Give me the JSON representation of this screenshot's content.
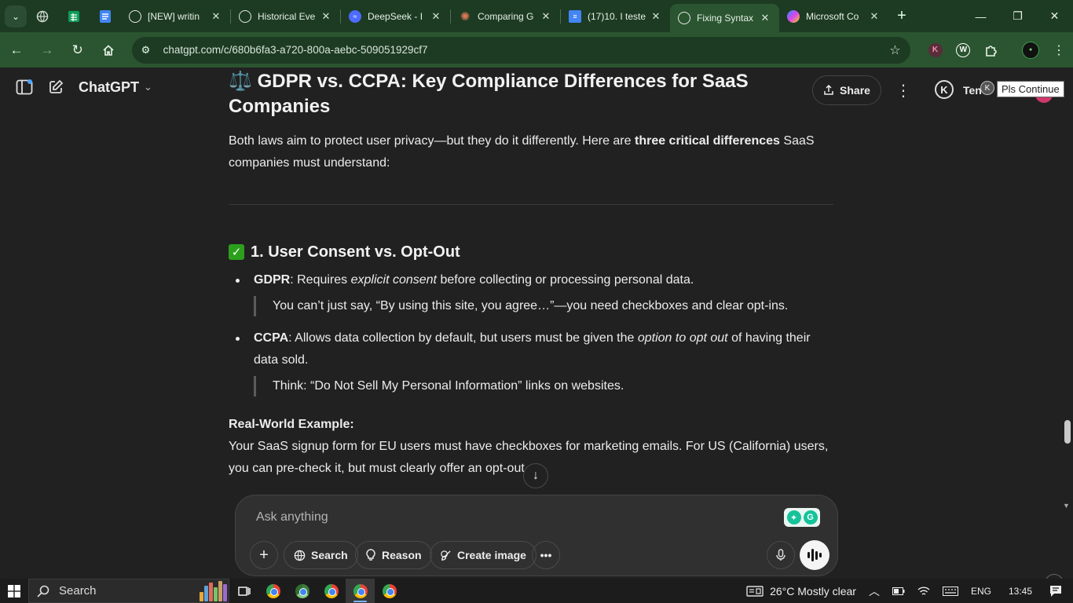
{
  "browser": {
    "tabs": [
      {
        "title": "[NEW] writin",
        "favicon": "openai-icon",
        "color": "#e8e8e8"
      },
      {
        "title": "Historical Eve",
        "favicon": "openai-icon",
        "color": "#e8e8e8"
      },
      {
        "title": "DeepSeek - I",
        "favicon": "deepseek-icon",
        "color": "#4d6bfe"
      },
      {
        "title": "Comparing G",
        "favicon": "claude-icon",
        "color": "#d97757"
      },
      {
        "title": "(17)10. I teste",
        "favicon": "docs-icon",
        "color": "#4285f4"
      },
      {
        "title": "Fixing Syntax",
        "favicon": "openai-icon",
        "color": "#e8e8e8",
        "active": true
      },
      {
        "title": "Microsoft Co",
        "favicon": "copilot-icon",
        "color": "#8b5cf6"
      }
    ],
    "url": "chatgpt.com/c/680b6fa3-a720-800a-aebc-509051929cf7"
  },
  "chat": {
    "model_label": "ChatGPT",
    "share_label": "Share",
    "user_initial": "K",
    "user_name_partial": "Ten",
    "tooltip": "Pls Continue"
  },
  "message": {
    "title_emoji": "⚖️",
    "title": "GDPR vs. CCPA: Key Compliance Differences for SaaS Companies",
    "intro_before": "Both laws aim to protect user privacy—but they do it differently. Here are ",
    "intro_bold": "three critical differences",
    "intro_after": " SaaS companies must understand:",
    "section_title": "1. User Consent vs. Opt-Out",
    "gdpr_label": "GDPR",
    "gdpr_text_1": ": Requires ",
    "gdpr_italic": "explicit consent",
    "gdpr_text_2": " before collecting or processing personal data.",
    "gdpr_quote": "You can’t just say, “By using this site, you agree…”—you need checkboxes and clear opt-ins.",
    "ccpa_label": "CCPA",
    "ccpa_text_1": ": Allows data collection by default, but users must be given the ",
    "ccpa_italic": "option to opt out",
    "ccpa_text_2": " of having their data sold.",
    "ccpa_quote": "Think: “Do Not Sell My Personal Information” links on websites.",
    "example_label": "Real-World Example:",
    "example_text": "Your SaaS signup form for EU users must have checkboxes for marketing emails. For US (California) users, you can pre-check it, but must clearly offer an opt-out"
  },
  "composer": {
    "placeholder": "Ask anything",
    "search_label": "Search",
    "reason_label": "Reason",
    "create_image_label": "Create image"
  },
  "taskbar": {
    "search_label": "Search",
    "weather": "26°C  Mostly clear",
    "language": "ENG",
    "time": "13:45"
  }
}
